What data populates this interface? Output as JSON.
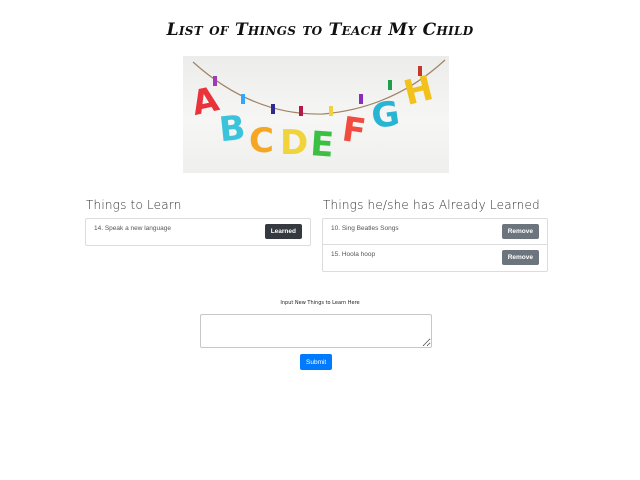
{
  "page": {
    "title": "List of Things to Teach My Child"
  },
  "banner": {
    "letters": [
      "A",
      "B",
      "C",
      "D",
      "E",
      "F",
      "G",
      "H"
    ]
  },
  "to_learn": {
    "heading": "Things to Learn",
    "items": [
      {
        "text": "14. Speak a new language",
        "button": "Learned"
      }
    ]
  },
  "learned": {
    "heading": "Things he/she has Already Learned",
    "items": [
      {
        "text": "10. Sing Beatles Songs",
        "button": "Remove"
      },
      {
        "text": "15. Hoola hoop",
        "button": "Remove"
      }
    ]
  },
  "form": {
    "label": "Input New Things to Learn Here",
    "placeholder": "",
    "submit": "Submit"
  },
  "colors": {
    "primary": "#007bff",
    "dark_button": "#343a40",
    "gray_button": "#6c757d",
    "letters": [
      "#e8333a",
      "#3bc3dc",
      "#f5a623",
      "#f1d33b",
      "#3cc043",
      "#f24b3f",
      "#27b5d3",
      "#f2c21b"
    ]
  }
}
